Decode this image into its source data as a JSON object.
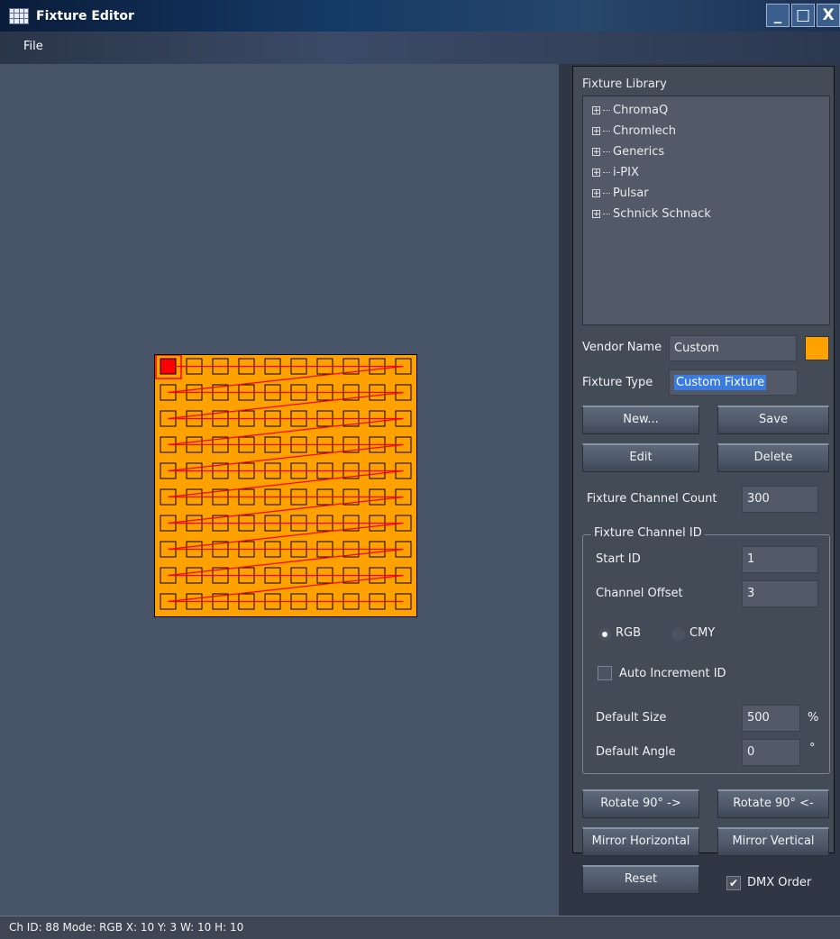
{
  "window": {
    "title": "Fixture Editor",
    "min": "_",
    "max": "□",
    "close": "X"
  },
  "menu": {
    "file": "File"
  },
  "library": {
    "label": "Fixture Library",
    "items": [
      "ChromaQ",
      "Chromlech",
      "Generics",
      "i-PIX",
      "Pulsar",
      "Schnick Schnack"
    ]
  },
  "vendor": {
    "label": "Vendor Name",
    "value": "Custom",
    "color": "#ffa200"
  },
  "fixture_type": {
    "label": "Fixture Type",
    "value": "Custom Fixture"
  },
  "buttons": {
    "new": "New...",
    "save": "Save",
    "edit": "Edit",
    "delete": "Delete",
    "rotate_cw": "Rotate 90° ->",
    "rotate_ccw": "Rotate 90° <-",
    "mirror_h": "Mirror Horizontal",
    "mirror_v": "Mirror Vertical",
    "reset": "Reset"
  },
  "channel_count": {
    "label": "Fixture Channel Count",
    "value": "300"
  },
  "channel_id": {
    "group_label": "Fixture Channel ID",
    "start_label": "Start ID",
    "start_value": "1",
    "offset_label": "Channel Offset",
    "offset_value": "3",
    "rgb": "RGB",
    "cmy": "CMY",
    "mode_selected": "RGB",
    "auto_increment": "Auto Increment ID",
    "size_label": "Default Size",
    "size_value": "500",
    "size_unit": "%",
    "angle_label": "Default Angle",
    "angle_value": "0",
    "angle_unit": "°"
  },
  "dmx_order": {
    "label": "DMX Order",
    "checked": true
  },
  "grid": {
    "cols": 10,
    "rows": 10,
    "fill": "#ffa200",
    "selected_color": "#ff0000",
    "path_color": "#ff0000"
  },
  "status": "Ch ID: 88  Mode: RGB  X: 10  Y: 3  W: 10  H: 10"
}
